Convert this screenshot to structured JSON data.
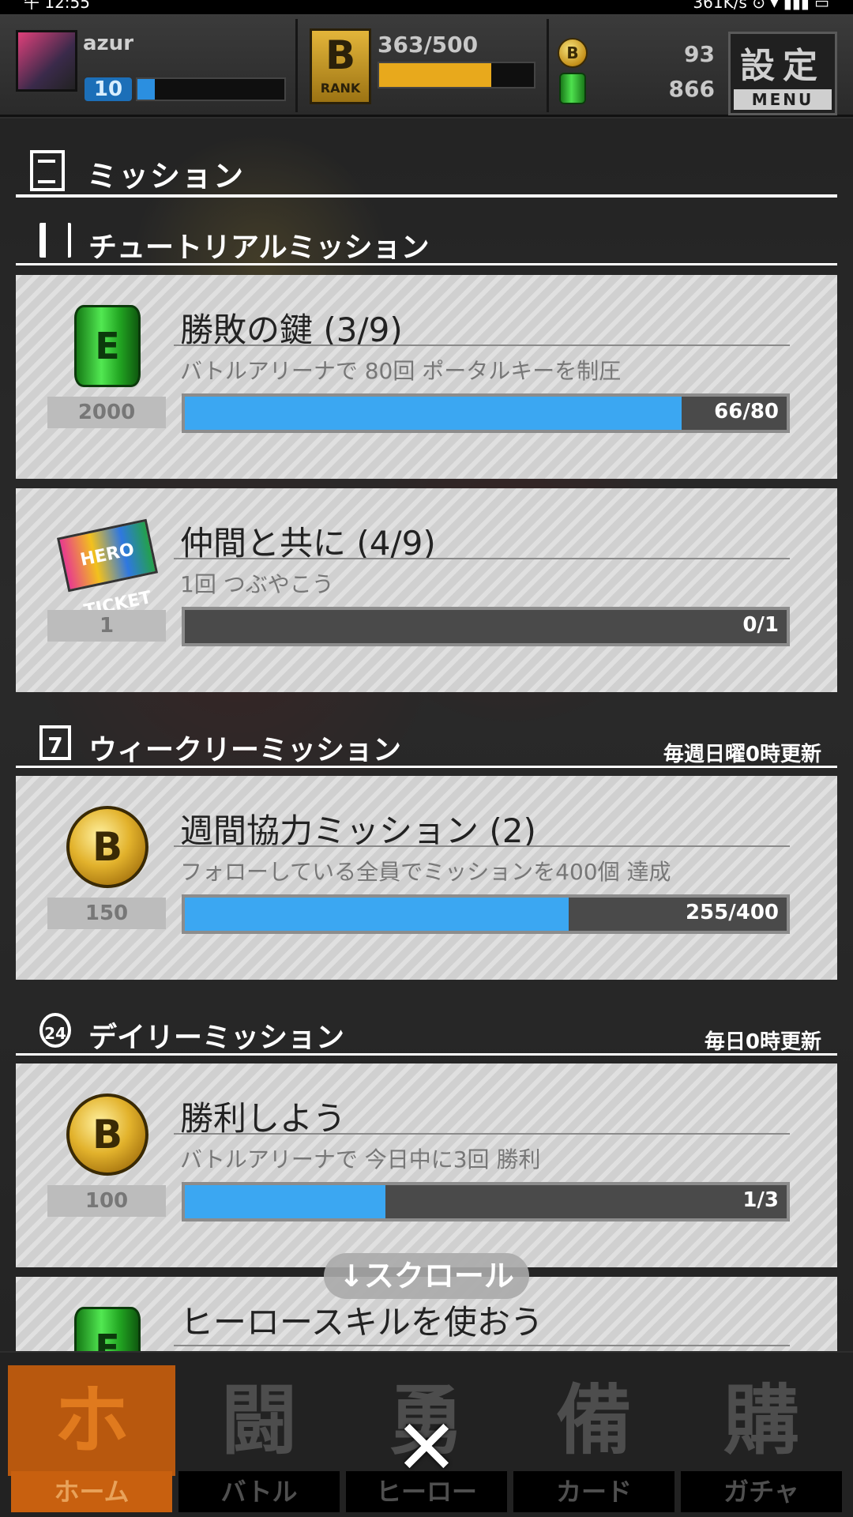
{
  "status_bar": {
    "left": "午 12:55",
    "right": "361K/s ⊙ ▾ ▮▮▮ ▭"
  },
  "hud": {
    "player_name": "azur",
    "level": "10",
    "level_progress": 0.12,
    "rank_icon_letter": "B",
    "rank_icon_label": "RANK",
    "rank_exp": "363/500",
    "rank_progress": 0.726,
    "coin_count": "93",
    "can_count": "866",
    "settings_kanji": "設定",
    "settings_label": "MENU"
  },
  "panel": {
    "title": "ミッション",
    "tutorial": {
      "heading": "チュートリアルミッション",
      "missions": [
        {
          "title": "勝敗の鍵 (3/9)",
          "description": "バトルアリーナで 80回 ポータルキーを制圧",
          "reward": "2000",
          "reward_icon": "green-can-icon",
          "progress_text": "66/80",
          "progress": 0.825
        },
        {
          "title": "仲間と共に (4/9)",
          "description": "1回 つぶやこう",
          "reward": "1",
          "reward_icon": "hero-ticket-icon",
          "reward_icon_text": "HERO TICKET",
          "progress_text": "0/1",
          "progress": 0
        }
      ]
    },
    "weekly": {
      "heading": "ウィークリーミッション",
      "note": "毎週日曜0時更新",
      "missions": [
        {
          "title": "週間協力ミッション (2)",
          "description": "フォローしている全員でミッションを400個 達成",
          "reward": "150",
          "reward_icon": "gold-coin-icon",
          "progress_text": "255/400",
          "progress": 0.6375
        }
      ]
    },
    "daily": {
      "heading": "デイリーミッション",
      "note": "毎日0時更新",
      "missions": [
        {
          "title": "勝利しよう",
          "description": "バトルアリーナで 今日中に3回 勝利",
          "reward": "100",
          "reward_icon": "gold-coin-icon",
          "progress_text": "1/3",
          "progress": 0.333
        },
        {
          "title": "ヒーロースキルを使おう",
          "reward_icon": "green-can-icon"
        }
      ]
    },
    "scroll_hint": "↓スクロール"
  },
  "bottom_nav": [
    {
      "glyph": "ホ",
      "label": "ホーム",
      "active": true
    },
    {
      "glyph": "闘",
      "label": "バトル",
      "active": false
    },
    {
      "glyph": "勇",
      "label": "ヒーロー",
      "active": false
    },
    {
      "glyph": "備",
      "label": "カード",
      "active": false
    },
    {
      "glyph": "購",
      "label": "ガチャ",
      "active": false
    }
  ],
  "close_symbol": "✕",
  "colors": {
    "progress_fill": "#3ba7f2",
    "rank_fill": "#e8a91c",
    "active_nav": "#c8600f"
  }
}
